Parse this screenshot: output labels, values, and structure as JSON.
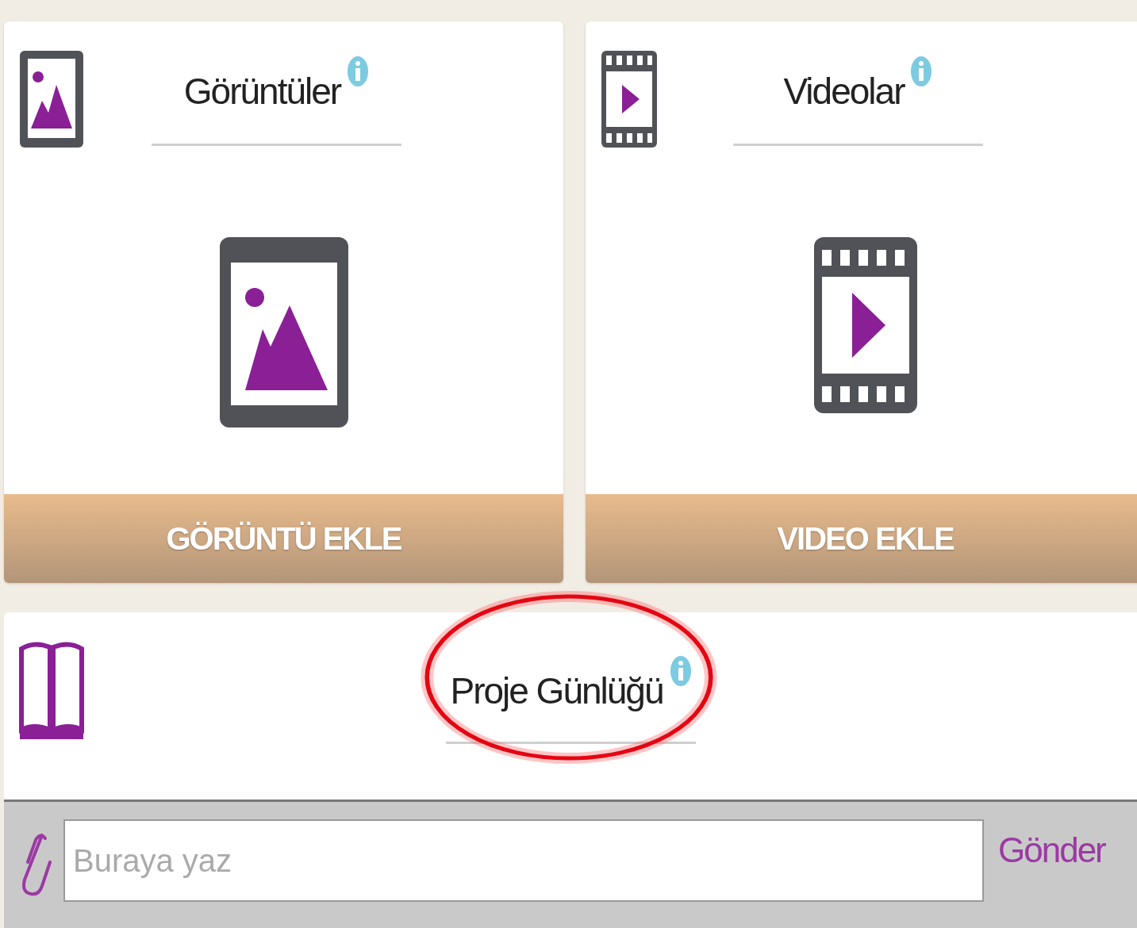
{
  "cards": [
    {
      "kind": "images",
      "title": "Görüntüler",
      "button": "GÖRÜNTÜ EKLE"
    },
    {
      "kind": "videos",
      "title": "Videolar",
      "button": "VIDEO EKLE"
    }
  ],
  "journal": {
    "title": "Proje Günlüğü",
    "highlighted": true,
    "placeholder": "Buraya yaz",
    "send": "Gönder"
  }
}
